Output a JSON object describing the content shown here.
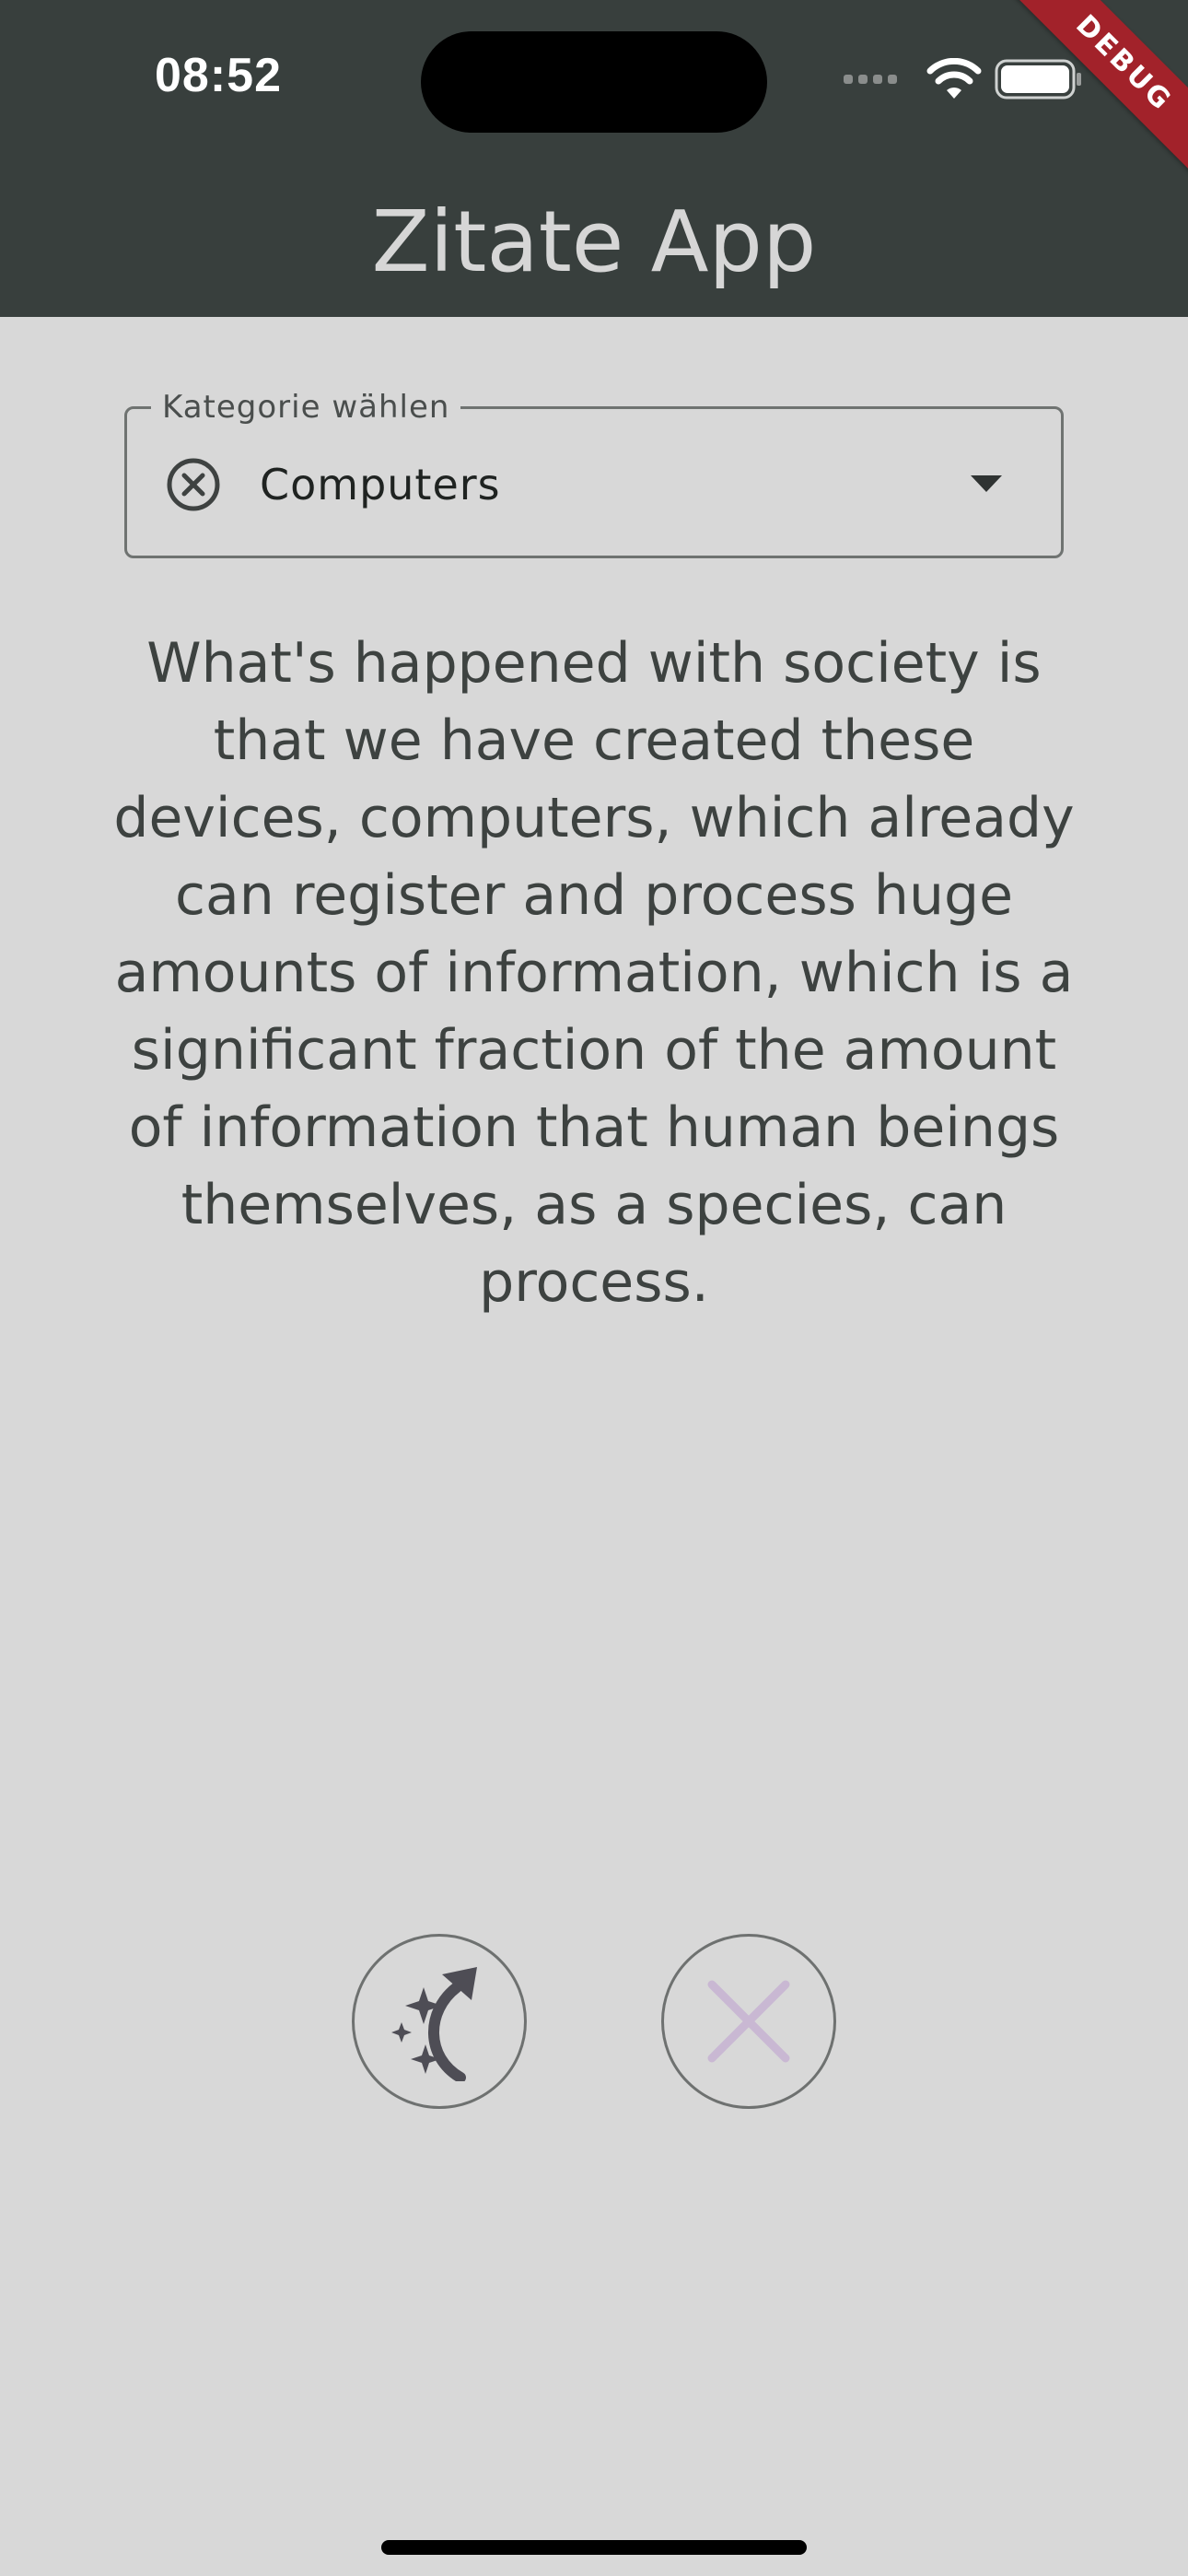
{
  "status_bar": {
    "time": "08:52",
    "debug_label": "DEBUG",
    "icons": [
      "cellular-dots-icon",
      "wifi-icon",
      "battery-icon"
    ]
  },
  "app_bar": {
    "title": "Zitate App"
  },
  "category_dropdown": {
    "label": "Kategorie wählen",
    "selected_value": "Computers",
    "clear_icon": "cancel-circle-icon",
    "arrow_icon": "dropdown-arrow-icon"
  },
  "quote": {
    "text": "What's happened with society is that we have created these devices, computers, which already can register and process huge amounts of information, which is a significant fraction of the amount of information that human beings themselves, as a species, can process."
  },
  "actions": {
    "new_quote_icon": "sparkle-redo-icon",
    "close_icon": "close-icon"
  },
  "colors": {
    "app_bar": "#383f3d",
    "background": "#d8d8d8",
    "debug_ribbon": "#a2222a",
    "close_icon": "#c9b8d3"
  }
}
